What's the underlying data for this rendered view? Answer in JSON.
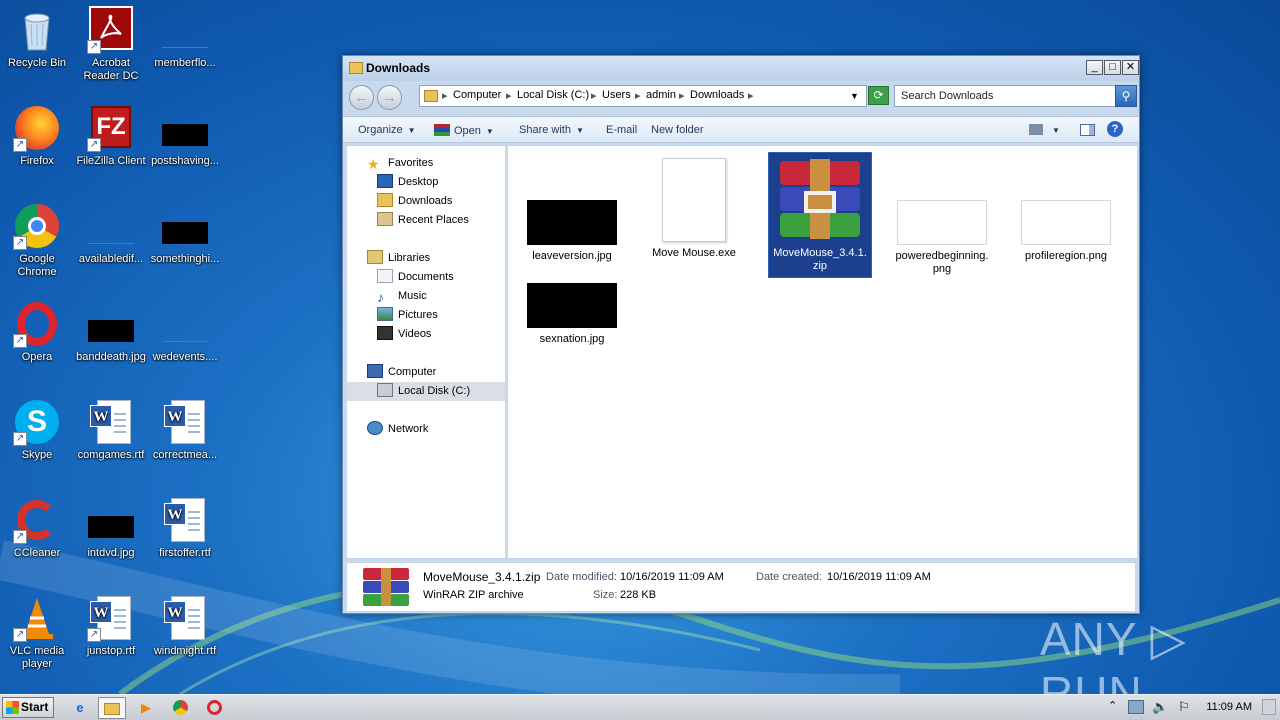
{
  "desktop": {
    "icons": [
      {
        "label": "Recycle Bin"
      },
      {
        "label": "Acrobat Reader DC"
      },
      {
        "label": "memberflo..."
      },
      {
        "label": "Firefox"
      },
      {
        "label": "FileZilla Client"
      },
      {
        "label": "postshaving..."
      },
      {
        "label": "Google Chrome"
      },
      {
        "label": "availabledif..."
      },
      {
        "label": "somethinghi..."
      },
      {
        "label": "Opera"
      },
      {
        "label": "banddeath.jpg"
      },
      {
        "label": "wedevents...."
      },
      {
        "label": "Skype"
      },
      {
        "label": "comgames.rtf"
      },
      {
        "label": "correctmea..."
      },
      {
        "label": "CCleaner"
      },
      {
        "label": "intdvd.jpg"
      },
      {
        "label": "firstoffer.rtf"
      },
      {
        "label": "VLC media player"
      },
      {
        "label": "junstop.rtf"
      },
      {
        "label": "windmight.rtf"
      }
    ]
  },
  "window": {
    "title": "Downloads",
    "buttons": {
      "minimize": "_",
      "maximize": "□",
      "close": "✕"
    },
    "breadcrumb": [
      "Computer",
      "Local Disk (C:)",
      "Users",
      "admin",
      "Downloads"
    ],
    "search_placeholder": "Search Downloads",
    "toolbar": {
      "organize": "Organize",
      "open": "Open",
      "share_with": "Share with",
      "email": "E-mail",
      "new_folder": "New folder"
    },
    "nav": {
      "favorites": "Favorites",
      "desktop": "Desktop",
      "downloads": "Downloads",
      "recent_places": "Recent Places",
      "libraries": "Libraries",
      "documents": "Documents",
      "music": "Music",
      "pictures": "Pictures",
      "videos": "Videos",
      "computer": "Computer",
      "local_disk": "Local Disk (C:)",
      "network": "Network"
    },
    "files": [
      {
        "name": "leaveversion.jpg"
      },
      {
        "name": "Move Mouse.exe"
      },
      {
        "name": "MoveMouse_3.4.1.zip",
        "line1": "MoveMouse_3.4.1.",
        "line2": "zip",
        "selected": true
      },
      {
        "name": "poweredbeginning.png",
        "line1": "poweredbeginning.",
        "line2": "png"
      },
      {
        "name": "profileregion.png"
      },
      {
        "name": "sexnation.jpg"
      }
    ],
    "details": {
      "filename": "MoveMouse_3.4.1.zip",
      "filetype": "WinRAR ZIP archive",
      "modified_label": "Date modified:",
      "modified_value": "10/16/2019 11:09 AM",
      "created_label": "Date created:",
      "created_value": "10/16/2019 11:09 AM",
      "size_label": "Size:",
      "size_value": "228 KB"
    }
  },
  "taskbar": {
    "start_label": "Start",
    "clock": "11:09 AM"
  },
  "watermark": "ANY ▷ RUN"
}
